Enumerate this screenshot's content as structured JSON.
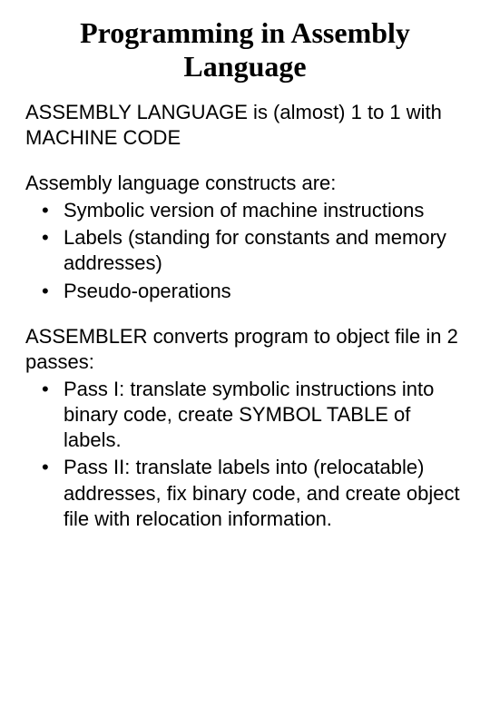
{
  "title": "Programming in Assembly Language",
  "intro": "ASSEMBLY LANGUAGE is (almost) 1 to 1 with MACHINE CODE",
  "constructs": {
    "lead": "Assembly language constructs are:",
    "items": [
      "Symbolic version of machine instructions",
      "Labels (standing for constants and memory addresses)",
      "Pseudo-operations"
    ]
  },
  "passes": {
    "lead": "ASSEMBLER converts program to object file in 2 passes:",
    "items": [
      "Pass I: translate symbolic instructions into binary code, create SYMBOL TABLE of labels.",
      " Pass II: translate labels into (relocatable) addresses, fix binary code, and create object file with relocation information."
    ]
  }
}
